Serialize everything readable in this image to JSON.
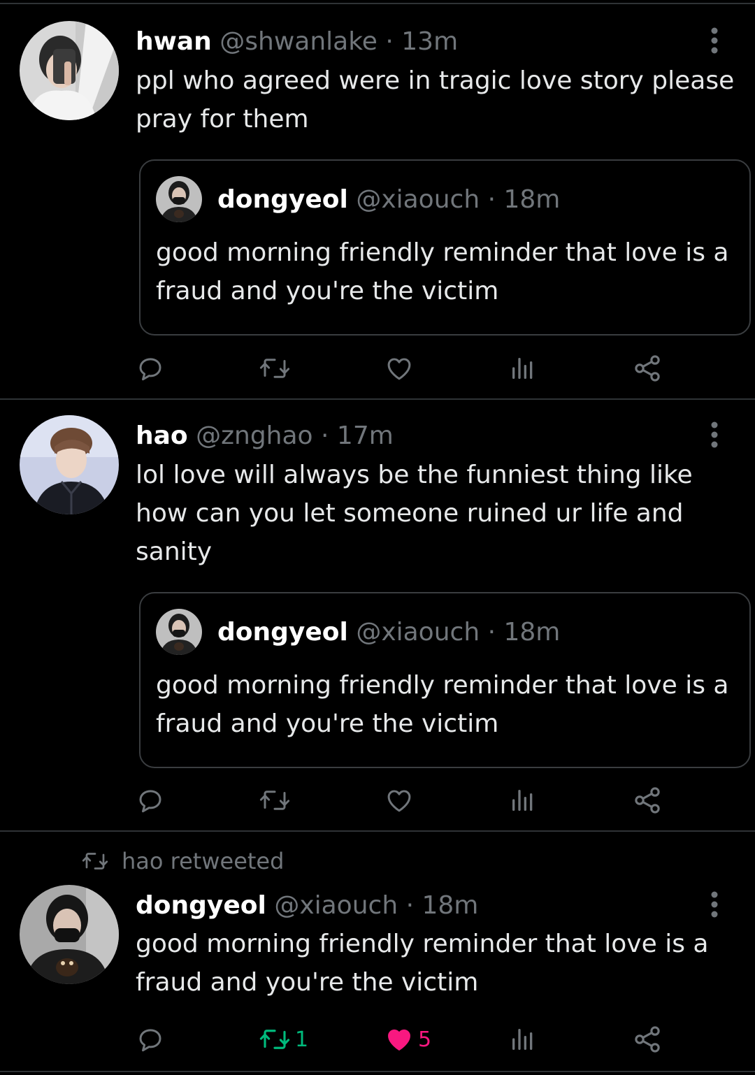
{
  "tweets": [
    {
      "name": "hwan",
      "handle": "@shwanlake",
      "time": "13m",
      "text": "ppl who agreed were in tragic love story please pray for them",
      "quote": {
        "name": "dongyeol",
        "handle": "@xiaouch",
        "time": "18m",
        "text": "good morning friendly reminder that love is a fraud and you're the victim"
      }
    },
    {
      "name": "hao",
      "handle": "@znghao",
      "time": "17m",
      "text": "lol love will always be the funniest thing like how can you let someone ruined ur life and sanity",
      "quote": {
        "name": "dongyeol",
        "handle": "@xiaouch",
        "time": "18m",
        "text": "good morning friendly reminder that love is a fraud and you're the victim"
      }
    },
    {
      "retweeted_by": "hao retweeted",
      "name": "dongyeol",
      "handle": "@xiaouch",
      "time": "18m",
      "text": "good morning friendly reminder that love is a fraud and you're the victim",
      "retweet_count": "1",
      "like_count": "5"
    }
  ],
  "separator": " · ",
  "colors": {
    "background": "#000000",
    "text": "#e7e9ea",
    "muted": "#71767b",
    "retweet_active": "#00ba7c",
    "like_active": "#f91880",
    "border": "#2f3336"
  },
  "icons": [
    "reply-icon",
    "retweet-icon",
    "like-icon",
    "views-icon",
    "share-icon",
    "more-icon"
  ]
}
